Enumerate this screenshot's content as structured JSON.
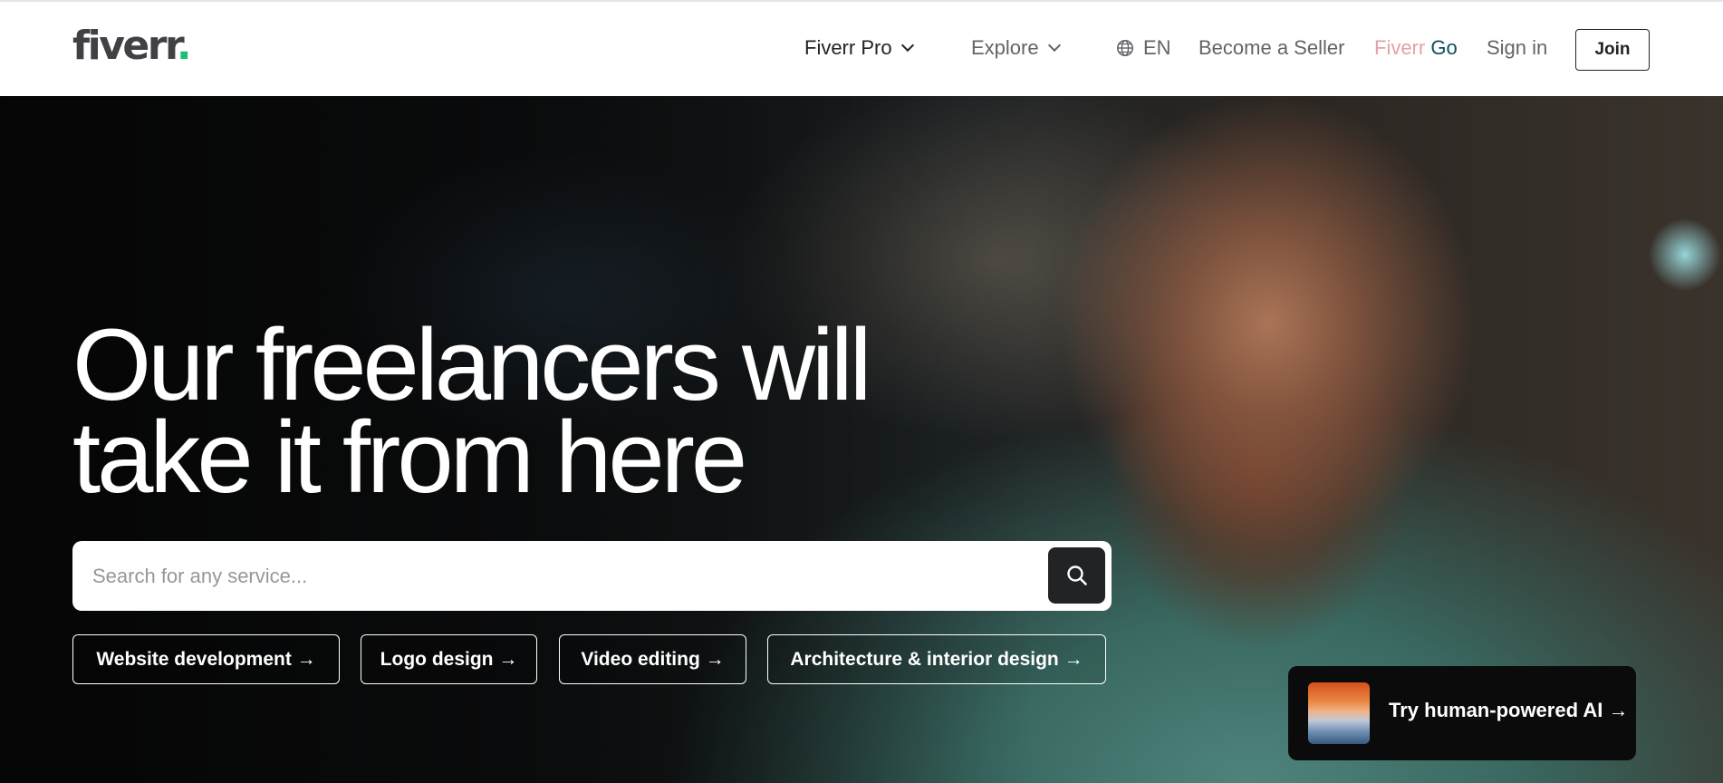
{
  "header": {
    "logo": "fiverr",
    "logo_dot": ".",
    "nav": {
      "fiverr_pro": "Fiverr Pro",
      "explore": "Explore",
      "language": "EN",
      "become_seller": "Become a Seller",
      "fiverr_go_a": "Fiverr",
      "fiverr_go_b": " Go",
      "sign_in": "Sign in",
      "join": "Join"
    }
  },
  "hero": {
    "headline_line1": "Our freelancers will",
    "headline_line2": "take it from here",
    "search": {
      "placeholder": "Search for any service...",
      "value": ""
    },
    "chips": [
      {
        "label": "Website development →"
      },
      {
        "label": "Logo design →"
      },
      {
        "label": "Video editing →"
      },
      {
        "label": "Architecture & interior design →"
      }
    ],
    "ai_card": {
      "label": "Try human-powered AI →"
    }
  },
  "icons": {
    "globe": "globe-icon",
    "search": "search-icon",
    "chevron": "chevron-down-icon"
  },
  "colors": {
    "brand_green": "#1dbf73",
    "text_dark": "#222325",
    "text_grey": "#62646a",
    "go_pink": "#e6a0a8",
    "go_teal": "#0d4d5b"
  }
}
